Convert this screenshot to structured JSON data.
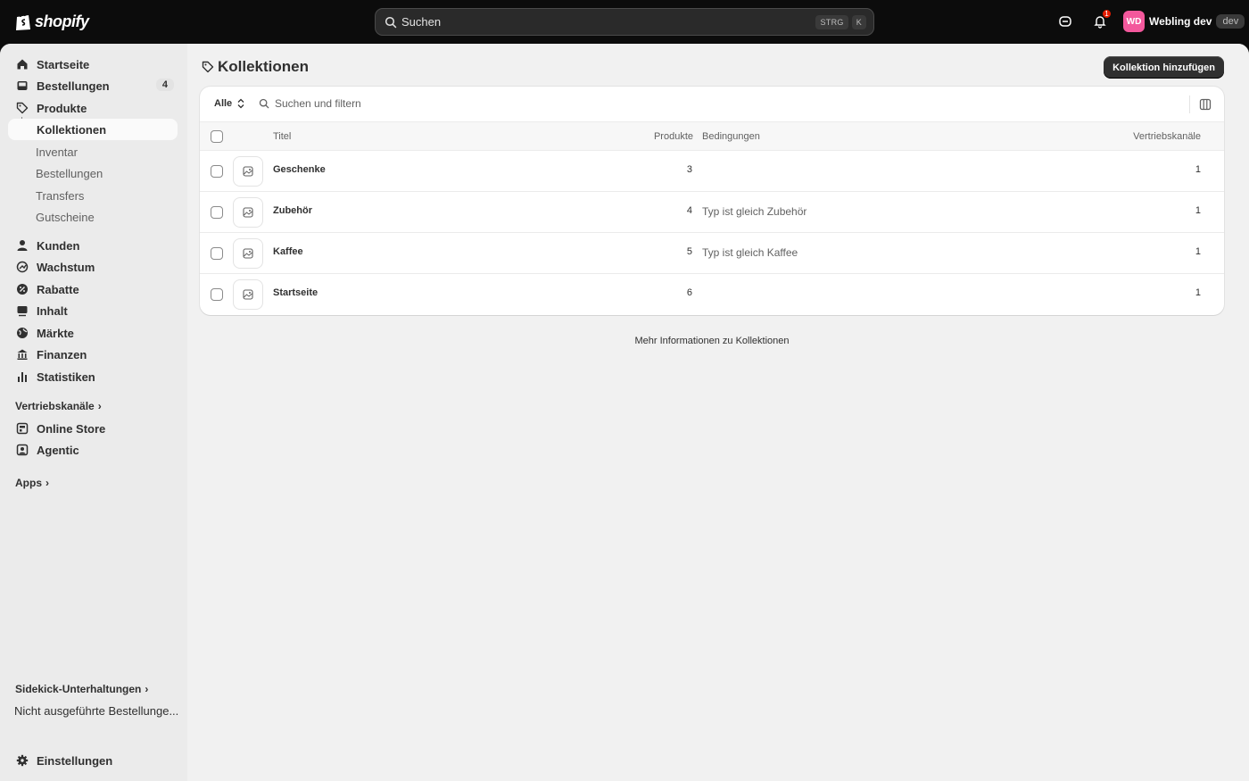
{
  "topbar": {
    "logo_text": "shopify",
    "search_placeholder": "Suchen",
    "kbd_1": "STRG",
    "kbd_2": "K",
    "notification_count": "1",
    "avatar_initials": "WD",
    "store_name": "Webling dev",
    "store_tag": "dev"
  },
  "sidebar": {
    "items": [
      {
        "label": "Startseite",
        "icon": "home-icon"
      },
      {
        "label": "Bestellungen",
        "icon": "inbox-icon",
        "badge": "4"
      },
      {
        "label": "Produkte",
        "icon": "tag-icon"
      },
      {
        "label": "Kollektionen",
        "active": true
      },
      {
        "label": "Inventar"
      },
      {
        "label": "Bestellungen"
      },
      {
        "label": "Transfers"
      },
      {
        "label": "Gutscheine"
      },
      {
        "label": "Kunden",
        "icon": "person-icon"
      },
      {
        "label": "Wachstum",
        "icon": "growth-icon"
      },
      {
        "label": "Rabatte",
        "icon": "discount-icon"
      },
      {
        "label": "Inhalt",
        "icon": "content-icon"
      },
      {
        "label": "Märkte",
        "icon": "globe-icon"
      },
      {
        "label": "Finanzen",
        "icon": "bank-icon"
      },
      {
        "label": "Statistiken",
        "icon": "chart-icon"
      }
    ],
    "section_channels": "Vertriebskanäle",
    "channels": [
      {
        "label": "Online Store",
        "icon": "store-icon"
      },
      {
        "label": "Agentic",
        "icon": "agent-icon"
      }
    ],
    "section_apps": "Apps",
    "section_sidekick": "Sidekick-Unterhaltungen",
    "pinned": "Nicht ausgeführte Bestellunge...",
    "settings": "Einstellungen"
  },
  "main": {
    "title": "Kollektionen",
    "add_button": "Kollektion hinzufügen",
    "filter_all": "Alle",
    "search_placeholder": "Suchen und filtern",
    "columns": [
      "Titel",
      "Produkte",
      "Bedingungen",
      "Vertriebskanäle"
    ],
    "rows": [
      {
        "title": "Geschenke",
        "products": "3",
        "conditions": "",
        "channels": "1"
      },
      {
        "title": "Zubehör",
        "products": "4",
        "conditions": "Typ ist gleich Zubehör",
        "channels": "1"
      },
      {
        "title": "Kaffee",
        "products": "5",
        "conditions": "Typ ist gleich Kaffee",
        "channels": "1"
      },
      {
        "title": "Startseite",
        "products": "6",
        "conditions": "",
        "channels": "1"
      }
    ],
    "more_info": "Mehr Informationen zu Kollektionen"
  },
  "colors": {
    "topbar": "#0c0c0c",
    "sidebar": "#ebebeb",
    "main_bg": "#f1f1f1",
    "primary_button": "#303030",
    "avatar": "#f3589c",
    "notification": "#e51c00"
  }
}
